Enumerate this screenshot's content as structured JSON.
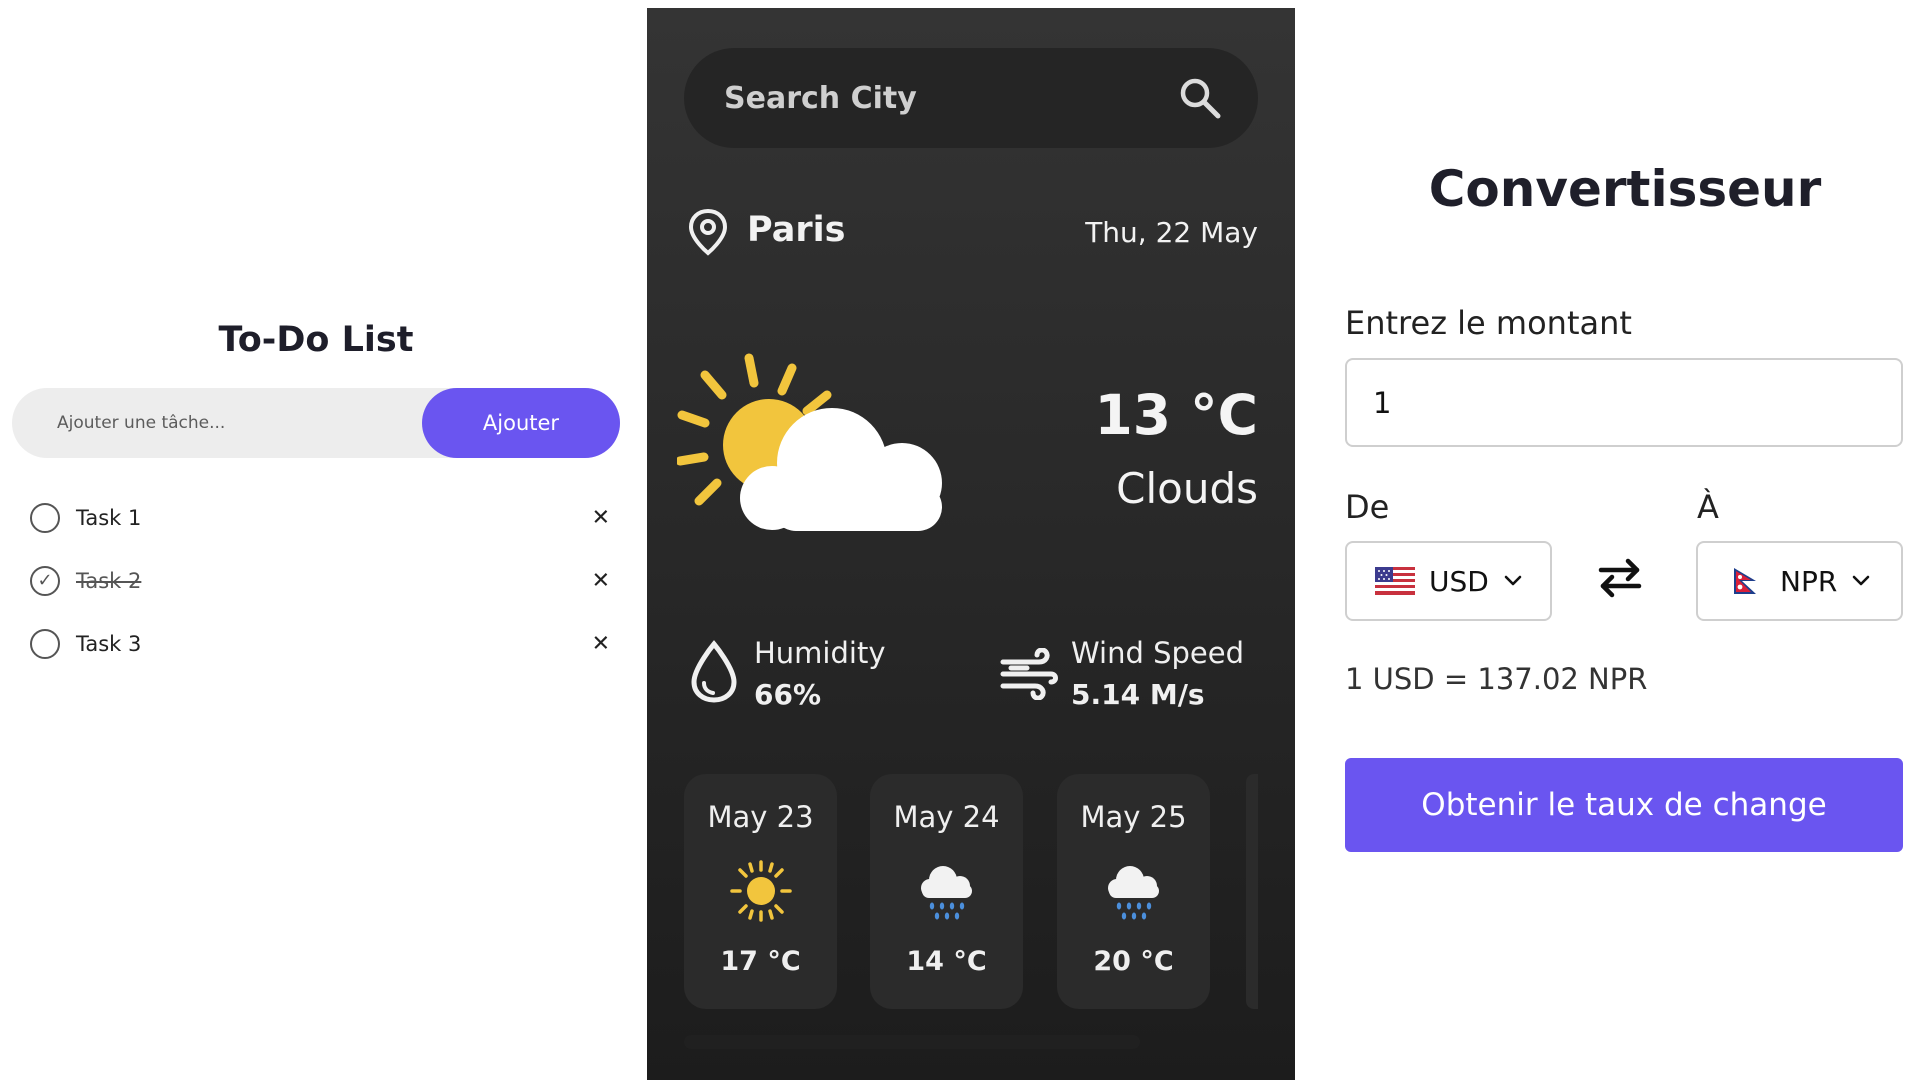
{
  "todo": {
    "title": "To-Do List",
    "input_placeholder": "Ajouter une tâche...",
    "add_label": "Ajouter",
    "items": [
      {
        "text": "Task 1",
        "done": false
      },
      {
        "text": "Task 2",
        "done": true
      },
      {
        "text": "Task 3",
        "done": false
      }
    ],
    "delete_glyph": "✕",
    "check_glyph": "✓"
  },
  "weather": {
    "search_placeholder": "Search City",
    "city": "Paris",
    "date": "Thu, 22 May",
    "temperature": "13 °C",
    "condition": "Clouds",
    "humidity_label": "Humidity",
    "humidity_value": "66%",
    "wind_label": "Wind Speed",
    "wind_value": "5.14 M/s",
    "forecast": [
      {
        "date": "May 23",
        "icon": "sun-icon",
        "temp": "17 °C"
      },
      {
        "date": "May 24",
        "icon": "rain-cloud-icon",
        "temp": "14 °C"
      },
      {
        "date": "May 25",
        "icon": "rain-cloud-icon",
        "temp": "20 °C"
      }
    ]
  },
  "converter": {
    "title": "Convertisseur",
    "amount_label": "Entrez le montant",
    "amount_value": "1",
    "from_label": "De",
    "to_label": "À",
    "from_currency": "USD",
    "to_currency": "NPR",
    "rate_text": "1 USD = 137.02 NPR",
    "button_label": "Obtenir le taux de change"
  },
  "colors": {
    "accent": "#6a55f0",
    "weather_bg": "#2a2a2a",
    "sun": "#f2c53d"
  }
}
